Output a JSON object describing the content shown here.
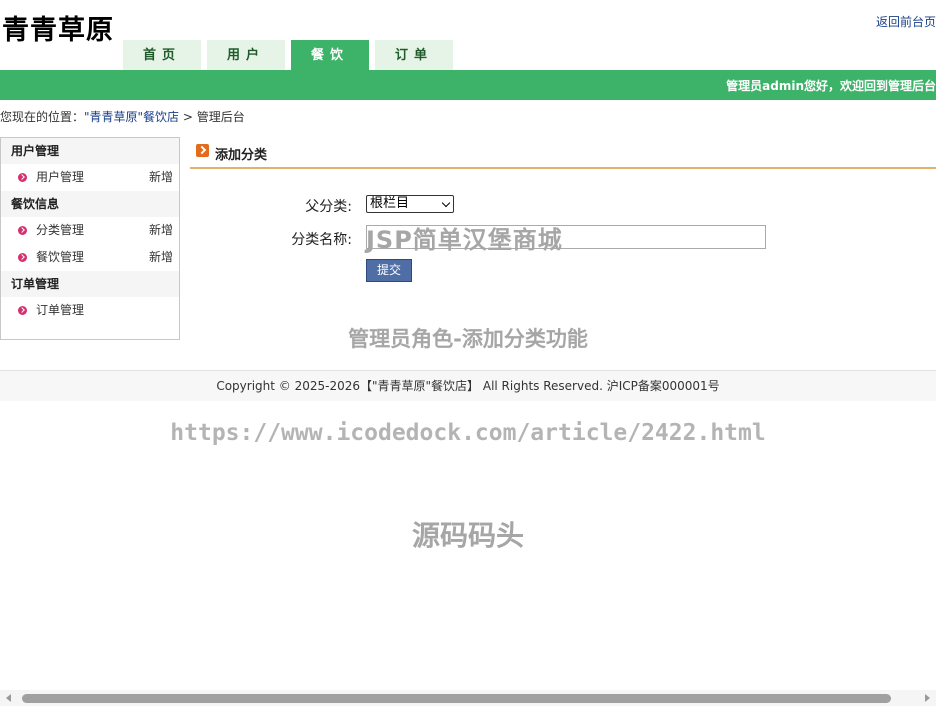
{
  "header": {
    "site_title": "青青草原",
    "back_link": "返回前台页",
    "nav_tabs": [
      {
        "label": "首页",
        "active": false
      },
      {
        "label": "用户",
        "active": false
      },
      {
        "label": "餐饮",
        "active": true
      },
      {
        "label": "订单",
        "active": false
      }
    ],
    "welcome": "管理员admin您好，欢迎回到管理后台"
  },
  "breadcrumb": {
    "prefix": "您现在的位置：",
    "link": "\"青青草原\"餐饮店",
    "separator": " > ",
    "current": "管理后台"
  },
  "sidebar": {
    "groups": [
      {
        "title": "用户管理",
        "items": [
          {
            "label": "用户管理",
            "add": "新增"
          }
        ]
      },
      {
        "title": "餐饮信息",
        "items": [
          {
            "label": "分类管理",
            "add": "新增"
          },
          {
            "label": "餐饮管理",
            "add": "新增"
          }
        ]
      },
      {
        "title": "订单管理",
        "items": [
          {
            "label": "订单管理",
            "add": ""
          }
        ]
      }
    ]
  },
  "panel": {
    "title": "添加分类",
    "parent_label": "父分类:",
    "parent_value": "根栏目",
    "name_label": "分类名称:",
    "name_value": "",
    "submit_label": "提交"
  },
  "watermarks": {
    "input_overlay": "JSP简单汉堡商城",
    "caption": "管理员角色-添加分类功能",
    "url": "https://www.icodedock.com/article/2422.html",
    "brand": "源码码头"
  },
  "footer": {
    "text": "Copyright © 2025-2026【\"青青草原\"餐饮店】 All Rights Reserved. 沪ICP备案000001号"
  },
  "colors": {
    "accent_green": "#3cb369",
    "tab_bg": "#e6f4e8",
    "button_blue": "#4f6ea6",
    "bullet_pink": "#d4306e",
    "underline_gold": "#e3b16a"
  }
}
